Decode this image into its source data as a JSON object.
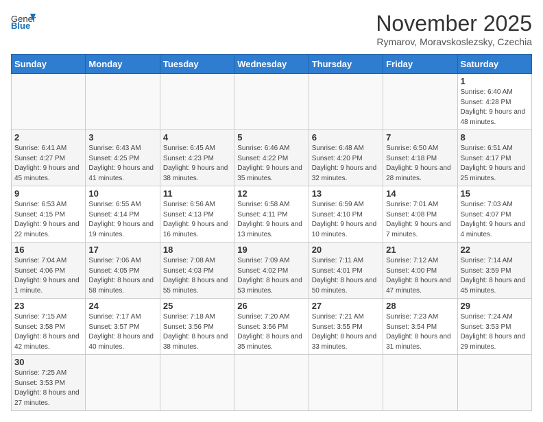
{
  "header": {
    "logo_general": "General",
    "logo_blue": "Blue",
    "title": "November 2025",
    "subtitle": "Rymarov, Moravskoslezsky, Czechia"
  },
  "weekdays": [
    "Sunday",
    "Monday",
    "Tuesday",
    "Wednesday",
    "Thursday",
    "Friday",
    "Saturday"
  ],
  "weeks": [
    [
      {
        "day": "",
        "info": ""
      },
      {
        "day": "",
        "info": ""
      },
      {
        "day": "",
        "info": ""
      },
      {
        "day": "",
        "info": ""
      },
      {
        "day": "",
        "info": ""
      },
      {
        "day": "",
        "info": ""
      },
      {
        "day": "1",
        "info": "Sunrise: 6:40 AM\nSunset: 4:28 PM\nDaylight: 9 hours and 48 minutes."
      }
    ],
    [
      {
        "day": "2",
        "info": "Sunrise: 6:41 AM\nSunset: 4:27 PM\nDaylight: 9 hours and 45 minutes."
      },
      {
        "day": "3",
        "info": "Sunrise: 6:43 AM\nSunset: 4:25 PM\nDaylight: 9 hours and 41 minutes."
      },
      {
        "day": "4",
        "info": "Sunrise: 6:45 AM\nSunset: 4:23 PM\nDaylight: 9 hours and 38 minutes."
      },
      {
        "day": "5",
        "info": "Sunrise: 6:46 AM\nSunset: 4:22 PM\nDaylight: 9 hours and 35 minutes."
      },
      {
        "day": "6",
        "info": "Sunrise: 6:48 AM\nSunset: 4:20 PM\nDaylight: 9 hours and 32 minutes."
      },
      {
        "day": "7",
        "info": "Sunrise: 6:50 AM\nSunset: 4:18 PM\nDaylight: 9 hours and 28 minutes."
      },
      {
        "day": "8",
        "info": "Sunrise: 6:51 AM\nSunset: 4:17 PM\nDaylight: 9 hours and 25 minutes."
      }
    ],
    [
      {
        "day": "9",
        "info": "Sunrise: 6:53 AM\nSunset: 4:15 PM\nDaylight: 9 hours and 22 minutes."
      },
      {
        "day": "10",
        "info": "Sunrise: 6:55 AM\nSunset: 4:14 PM\nDaylight: 9 hours and 19 minutes."
      },
      {
        "day": "11",
        "info": "Sunrise: 6:56 AM\nSunset: 4:13 PM\nDaylight: 9 hours and 16 minutes."
      },
      {
        "day": "12",
        "info": "Sunrise: 6:58 AM\nSunset: 4:11 PM\nDaylight: 9 hours and 13 minutes."
      },
      {
        "day": "13",
        "info": "Sunrise: 6:59 AM\nSunset: 4:10 PM\nDaylight: 9 hours and 10 minutes."
      },
      {
        "day": "14",
        "info": "Sunrise: 7:01 AM\nSunset: 4:08 PM\nDaylight: 9 hours and 7 minutes."
      },
      {
        "day": "15",
        "info": "Sunrise: 7:03 AM\nSunset: 4:07 PM\nDaylight: 9 hours and 4 minutes."
      }
    ],
    [
      {
        "day": "16",
        "info": "Sunrise: 7:04 AM\nSunset: 4:06 PM\nDaylight: 9 hours and 1 minute."
      },
      {
        "day": "17",
        "info": "Sunrise: 7:06 AM\nSunset: 4:05 PM\nDaylight: 8 hours and 58 minutes."
      },
      {
        "day": "18",
        "info": "Sunrise: 7:08 AM\nSunset: 4:03 PM\nDaylight: 8 hours and 55 minutes."
      },
      {
        "day": "19",
        "info": "Sunrise: 7:09 AM\nSunset: 4:02 PM\nDaylight: 8 hours and 53 minutes."
      },
      {
        "day": "20",
        "info": "Sunrise: 7:11 AM\nSunset: 4:01 PM\nDaylight: 8 hours and 50 minutes."
      },
      {
        "day": "21",
        "info": "Sunrise: 7:12 AM\nSunset: 4:00 PM\nDaylight: 8 hours and 47 minutes."
      },
      {
        "day": "22",
        "info": "Sunrise: 7:14 AM\nSunset: 3:59 PM\nDaylight: 8 hours and 45 minutes."
      }
    ],
    [
      {
        "day": "23",
        "info": "Sunrise: 7:15 AM\nSunset: 3:58 PM\nDaylight: 8 hours and 42 minutes."
      },
      {
        "day": "24",
        "info": "Sunrise: 7:17 AM\nSunset: 3:57 PM\nDaylight: 8 hours and 40 minutes."
      },
      {
        "day": "25",
        "info": "Sunrise: 7:18 AM\nSunset: 3:56 PM\nDaylight: 8 hours and 38 minutes."
      },
      {
        "day": "26",
        "info": "Sunrise: 7:20 AM\nSunset: 3:56 PM\nDaylight: 8 hours and 35 minutes."
      },
      {
        "day": "27",
        "info": "Sunrise: 7:21 AM\nSunset: 3:55 PM\nDaylight: 8 hours and 33 minutes."
      },
      {
        "day": "28",
        "info": "Sunrise: 7:23 AM\nSunset: 3:54 PM\nDaylight: 8 hours and 31 minutes."
      },
      {
        "day": "29",
        "info": "Sunrise: 7:24 AM\nSunset: 3:53 PM\nDaylight: 8 hours and 29 minutes."
      }
    ],
    [
      {
        "day": "30",
        "info": "Sunrise: 7:25 AM\nSunset: 3:53 PM\nDaylight: 8 hours and 27 minutes."
      },
      {
        "day": "",
        "info": ""
      },
      {
        "day": "",
        "info": ""
      },
      {
        "day": "",
        "info": ""
      },
      {
        "day": "",
        "info": ""
      },
      {
        "day": "",
        "info": ""
      },
      {
        "day": "",
        "info": ""
      }
    ]
  ]
}
